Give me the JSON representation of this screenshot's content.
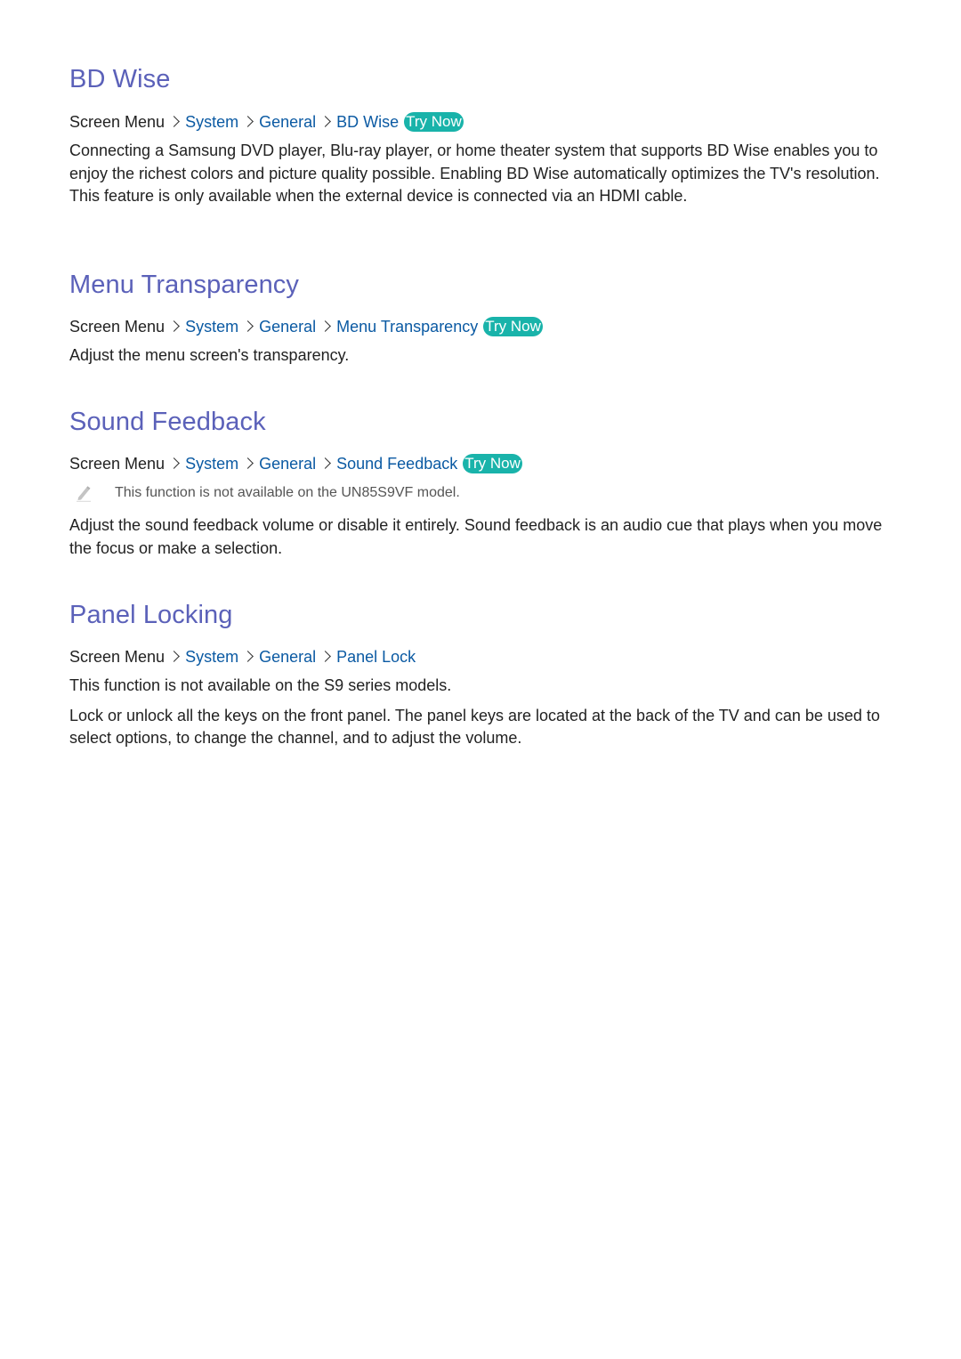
{
  "colors": {
    "heading": "#5b61b9",
    "link": "#0b5aa3",
    "try_now_bg": "#19b3aa",
    "body_text": "#222222"
  },
  "sections": [
    {
      "title": "BD Wise",
      "breadcrumb": [
        "Screen Menu",
        "System",
        "General",
        "BD Wise"
      ],
      "try_now": "Try Now",
      "paragraphs": [
        "Connecting a Samsung DVD player, Blu-ray player, or home theater system that supports BD Wise enables you to enjoy the richest colors and picture quality possible. Enabling BD Wise automatically optimizes the TV's resolution. This feature is only available when the external device is connected via an HDMI cable."
      ]
    },
    {
      "title": "Menu Transparency",
      "breadcrumb": [
        "Screen Menu",
        "System",
        "General",
        "Menu Transparency"
      ],
      "try_now": "Try Now",
      "paragraphs": [
        "Adjust the menu screen's transparency."
      ]
    },
    {
      "title": "Sound Feedback",
      "breadcrumb": [
        "Screen Menu",
        "System",
        "General",
        "Sound Feedback"
      ],
      "try_now": "Try Now",
      "note": {
        "icon": "pencil-icon",
        "text": "This function is not available on the UN85S9VF model."
      },
      "paragraphs": [
        "Adjust the sound feedback volume or disable it entirely. Sound feedback is an audio cue that plays when you move the focus or make a selection."
      ]
    },
    {
      "title": "Panel Locking",
      "breadcrumb": [
        "Screen Menu",
        "System",
        "General",
        "Panel Lock"
      ],
      "paragraphs": [
        "This function is not available on the S9 series models.",
        "Lock or unlock all the keys on the front panel. The panel keys are located at the back of the TV and can be used to select options, to change the channel, and to adjust the volume."
      ]
    }
  ]
}
